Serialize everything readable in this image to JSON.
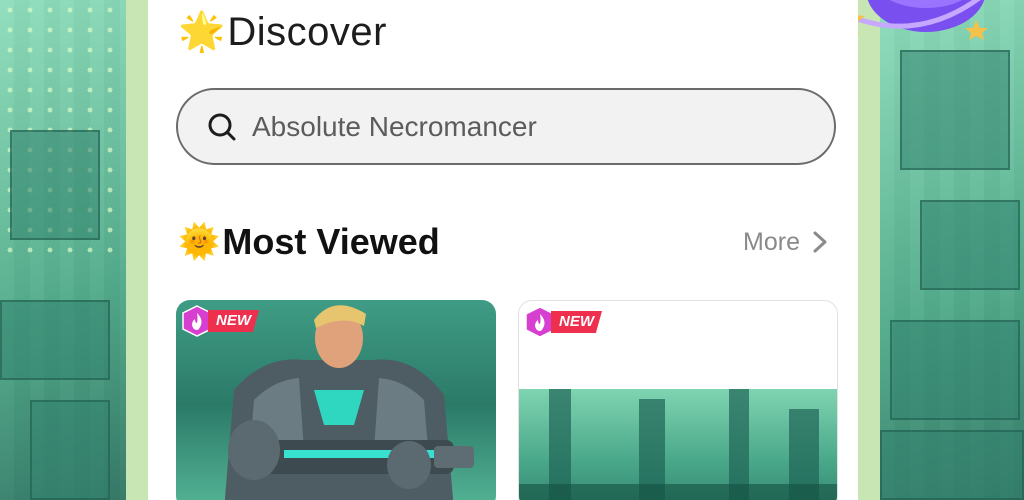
{
  "header": {
    "emoji": "🌟",
    "title": "Discover"
  },
  "search": {
    "placeholder": "Absolute Necromancer"
  },
  "section": {
    "emoji": "🌞",
    "title": "Most Viewed",
    "more_label": "More"
  },
  "cards": [
    {
      "badge": "NEW"
    },
    {
      "badge": "NEW"
    }
  ],
  "colors": {
    "accent_badge": "#ee2f4e",
    "badge_hex": "#d63fd0",
    "bg_scene": "#6fc7a3",
    "side_strip": "#c8e6b4"
  },
  "icons": {
    "search": "search-icon",
    "more": "chevron-right-icon",
    "badge": "flame-icon"
  }
}
